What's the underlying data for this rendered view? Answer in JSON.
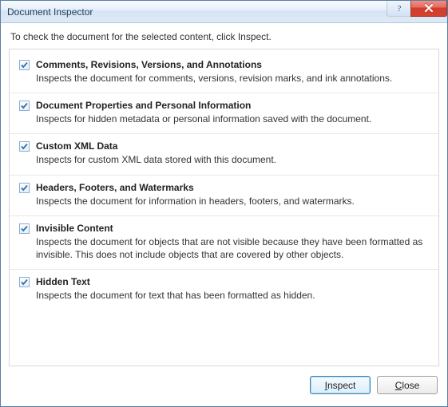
{
  "window": {
    "title": "Document Inspector",
    "help_tooltip": "Help",
    "close_tooltip": "Close"
  },
  "instruction": "To check the document for the selected content, click Inspect.",
  "options": [
    {
      "checked": true,
      "title": "Comments, Revisions, Versions, and Annotations",
      "desc": "Inspects the document for comments, versions, revision marks, and ink annotations."
    },
    {
      "checked": true,
      "title": "Document Properties and Personal Information",
      "desc": "Inspects for hidden metadata or personal information saved with the document."
    },
    {
      "checked": true,
      "title": "Custom XML Data",
      "desc": "Inspects for custom XML data stored with this document."
    },
    {
      "checked": true,
      "title": "Headers, Footers, and Watermarks",
      "desc": "Inspects the document for information in headers, footers, and watermarks."
    },
    {
      "checked": true,
      "title": "Invisible Content",
      "desc": "Inspects the document for objects that are not visible because they have been formatted as invisible. This does not include objects that are covered by other objects."
    },
    {
      "checked": true,
      "title": "Hidden Text",
      "desc": "Inspects the document for text that has been formatted as hidden."
    }
  ],
  "buttons": {
    "inspect_pre": "",
    "inspect_mnemonic": "I",
    "inspect_post": "nspect",
    "close_pre": "",
    "close_mnemonic": "C",
    "close_post": "lose"
  }
}
